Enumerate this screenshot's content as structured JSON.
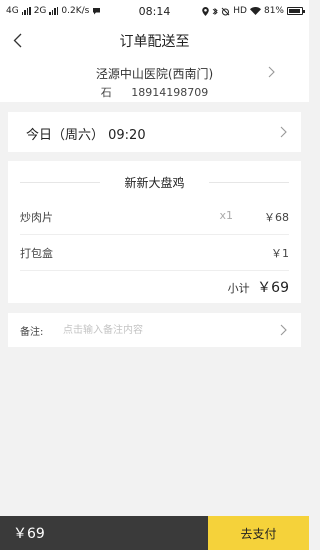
{
  "status_bar": {
    "net1": "4G",
    "net2": "2G",
    "speed": "0.2K/s",
    "time": "08:14",
    "hd": "HD",
    "battery": "81%"
  },
  "header": {
    "title": "订单配送至",
    "address": "泾源中山医院(西南门)",
    "contact_name": "石",
    "contact_phone": "18914198709"
  },
  "delivery_time": {
    "label": "今日（周六） 09:20"
  },
  "order": {
    "shop_name": "新新大盘鸡",
    "items": [
      {
        "name": "炒肉片",
        "qty": "x1",
        "price": "￥68"
      },
      {
        "name": "打包盒",
        "qty": "",
        "price": "￥1"
      }
    ],
    "subtotal_label": "小计",
    "subtotal_value": "￥69"
  },
  "note": {
    "label": "备注:",
    "placeholder": "点击输入备注内容"
  },
  "bottom_bar": {
    "total": "￥69",
    "pay_label": "去支付"
  },
  "colors": {
    "accent_yellow": "#f5d23a",
    "dark_bar": "#3a3a3a",
    "background": "#f2f2f2"
  },
  "icons": {
    "back": "chevron-left-icon",
    "row_arrow": "chevron-right-icon"
  }
}
